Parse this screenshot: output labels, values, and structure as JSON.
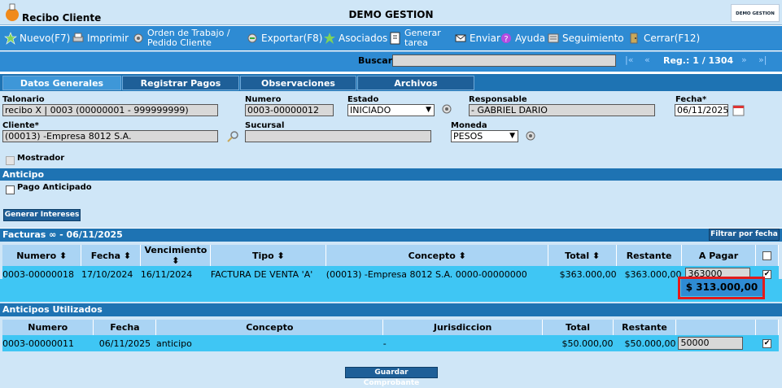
{
  "window": {
    "title": "Recibo Cliente",
    "app_name": "DEMO GESTION",
    "logo_text": "DEMO GESTION"
  },
  "toolbar": {
    "new": "Nuevo(F7)",
    "print": "Imprimir",
    "work_order_l1": "Orden de Trabajo /",
    "work_order_l2": "Pedido Cliente",
    "export": "Exportar(F8)",
    "associated": "Asociados",
    "task_l1": "Generar",
    "task_l2": "tarea",
    "send": "Enviar",
    "help": "Ayuda",
    "tracking": "Seguimiento",
    "close": "Cerrar(F12)"
  },
  "search": {
    "label": "Buscar",
    "value": "",
    "reg_label": "Reg.: 1 / 1304"
  },
  "tabs": [
    "Datos Generales",
    "Registrar Pagos",
    "Observaciones",
    "Archivos"
  ],
  "form": {
    "talonario_label": "Talonario",
    "talonario_value": "recibo X | 0003 (00000001 - 999999999)",
    "numero_label": "Numero",
    "numero_value": "0003-00000012",
    "estado_label": "Estado",
    "estado_value": "INICIADO",
    "responsable_label": "Responsable",
    "responsable_value": "- GABRIEL DARIO",
    "fecha_label": "Fecha*",
    "fecha_value": "06/11/2025",
    "cliente_label": "Cliente*",
    "cliente_value": "(00013) -Empresa 8012 S.A.",
    "sucursal_label": "Sucursal",
    "sucursal_value": "",
    "moneda_label": "Moneda",
    "moneda_value": "PESOS",
    "mostrador_label": "Mostrador"
  },
  "anticipo": {
    "title": "Anticipo",
    "pago_anticipado": "Pago Anticipado",
    "generar_intereses": "Generar Intereses"
  },
  "facturas": {
    "title": "Facturas ∞ - 06/11/2025",
    "filter_button": "Filtrar por fecha",
    "headers": [
      "Numero",
      "Fecha",
      "Vencimiento",
      "Tipo",
      "Concepto",
      "Total",
      "Restante",
      "A Pagar"
    ],
    "rows": [
      {
        "numero": "0003-00000018",
        "fecha": "17/10/2024",
        "vencimiento": "16/11/2024",
        "tipo": "FACTURA DE VENTA 'A'",
        "concepto": "(00013) -Empresa 8012 S.A. 0000-00000000",
        "total": "$363.000,00",
        "restante": "$363.000,00",
        "a_pagar": "363000"
      }
    ],
    "total_to_pay": "$ 313.000,00"
  },
  "anticipos_utilizados": {
    "title": "Anticipos Utilizados",
    "headers": [
      "Numero",
      "Fecha",
      "Concepto",
      "Jurisdiccion",
      "Total",
      "Restante"
    ],
    "rows": [
      {
        "numero": "0003-00000011",
        "fecha": "06/11/2025",
        "concepto": "anticipo",
        "jurisdiccion": "-",
        "total": "$50.000,00",
        "restante": "$50.000,00",
        "a_pagar": "50000"
      }
    ]
  },
  "footer": {
    "save_button": "Guardar Comprobante"
  }
}
